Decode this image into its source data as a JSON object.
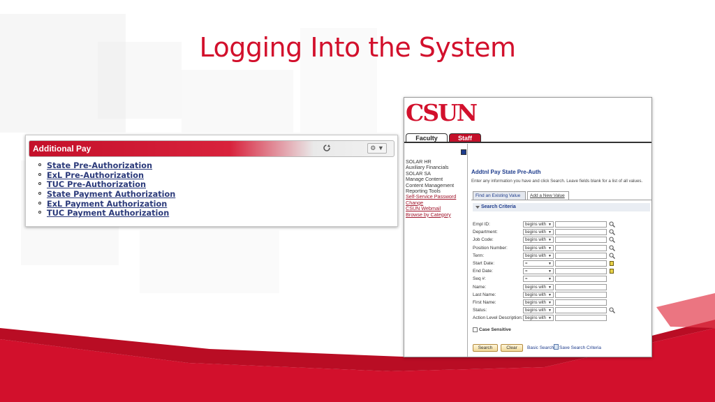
{
  "slide": {
    "title": "Logging Into the System"
  },
  "colors": {
    "brand_red": "#d2102c",
    "link_blue": "#2b3a7a",
    "ps_blue": "#1e3c8c"
  },
  "additional_pay": {
    "title": "Additional Pay",
    "links": [
      "State Pre-Authorization",
      "ExL Pre-Authorization",
      "TUC Pre-Authorization",
      "State Payment Authorization",
      "ExL Payment Authorization",
      "TUC Payment Authorization"
    ],
    "icons": {
      "refresh": "refresh-icon",
      "settings": "gear-icon"
    }
  },
  "csun": {
    "logo": "CSUN",
    "tabs": {
      "faculty": "Faculty",
      "staff": "Staff"
    },
    "sidebar": [
      {
        "label": "SOLAR HR",
        "link": false
      },
      {
        "label": "Auxiliary Financials",
        "link": false
      },
      {
        "label": "SOLAR SA",
        "link": false
      },
      {
        "label": "Manage Content",
        "link": false
      },
      {
        "label": "Content Management",
        "link": false
      },
      {
        "label": "Reporting Tools",
        "link": false
      },
      {
        "label": "Self-Service Password Change",
        "link": true
      },
      {
        "label": "CSUN Webmail",
        "link": true
      },
      {
        "label": "Browse by Category",
        "link": true
      }
    ],
    "page_title": "Addtnl Pay State Pre-Auth",
    "instructions": "Enter any information you have and click Search. Leave fields blank for a list of all values.",
    "page_tabs": {
      "find": "Find an Existing Value",
      "add": "Add a New Value"
    },
    "search_criteria": "Search Criteria",
    "fields": [
      {
        "label": "Empl ID:",
        "op": "begins with",
        "lookup": true
      },
      {
        "label": "Department:",
        "op": "begins with",
        "lookup": true
      },
      {
        "label": "Job Code:",
        "op": "begins with",
        "lookup": true
      },
      {
        "label": "Position Number:",
        "op": "begins with",
        "lookup": true
      },
      {
        "label": "Term:",
        "op": "begins with",
        "lookup": true
      },
      {
        "label": "Start Date:",
        "op": "=",
        "calendar": true
      },
      {
        "label": "End Date:",
        "op": "=",
        "calendar": true
      },
      {
        "label": "Seq #:",
        "op": "="
      },
      {
        "label": "Name:",
        "op": "begins with"
      },
      {
        "label": "Last Name:",
        "op": "begins with"
      },
      {
        "label": "First Name:",
        "op": "begins with"
      },
      {
        "label": "Status:",
        "op": "begins with",
        "lookup": true
      },
      {
        "label": "Action Level Description:",
        "op": "begins with"
      }
    ],
    "case_sensitive": "Case Sensitive",
    "buttons": {
      "search": "Search",
      "clear": "Clear"
    },
    "links": {
      "basic_search": "Basic Search",
      "save_search": "Save Search Criteria"
    }
  }
}
